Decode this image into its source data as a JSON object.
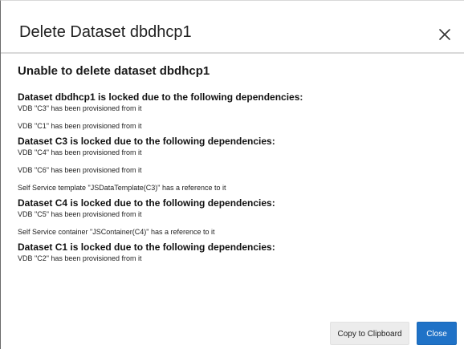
{
  "dialog": {
    "title": "Delete Dataset dbdhcp1",
    "heading": "Unable to delete dataset dbdhcp1",
    "sections": [
      {
        "title": "Dataset dbdhcp1 is locked due to the following dependencies:",
        "items": [
          "VDB \"C3\" has been provisioned from it",
          "VDB \"C1\" has been provisioned from it"
        ]
      },
      {
        "title": "Dataset C3 is locked due to the following dependencies:",
        "items": [
          "VDB \"C4\" has been provisioned from it",
          "VDB \"C6\" has been provisioned from it",
          "Self Service template \"JSDataTemplate(C3)\" has a reference to it"
        ]
      },
      {
        "title": "Dataset C4 is locked due to the following dependencies:",
        "items": [
          "VDB \"C5\" has been provisioned from it",
          "Self Service container \"JSContainer(C4)\" has a reference to it"
        ]
      },
      {
        "title": "Dataset C1 is locked due to the following dependencies:",
        "items": [
          "VDB \"C2\" has been provisioned from it"
        ]
      }
    ],
    "buttons": {
      "copy_label": "Copy to Clipboard",
      "close_label": "Close"
    }
  },
  "icons": {
    "close": "close-icon"
  },
  "colors": {
    "primary_button": "#1f72c7",
    "secondary_button": "#ececec",
    "divider": "#d9d9d9"
  }
}
